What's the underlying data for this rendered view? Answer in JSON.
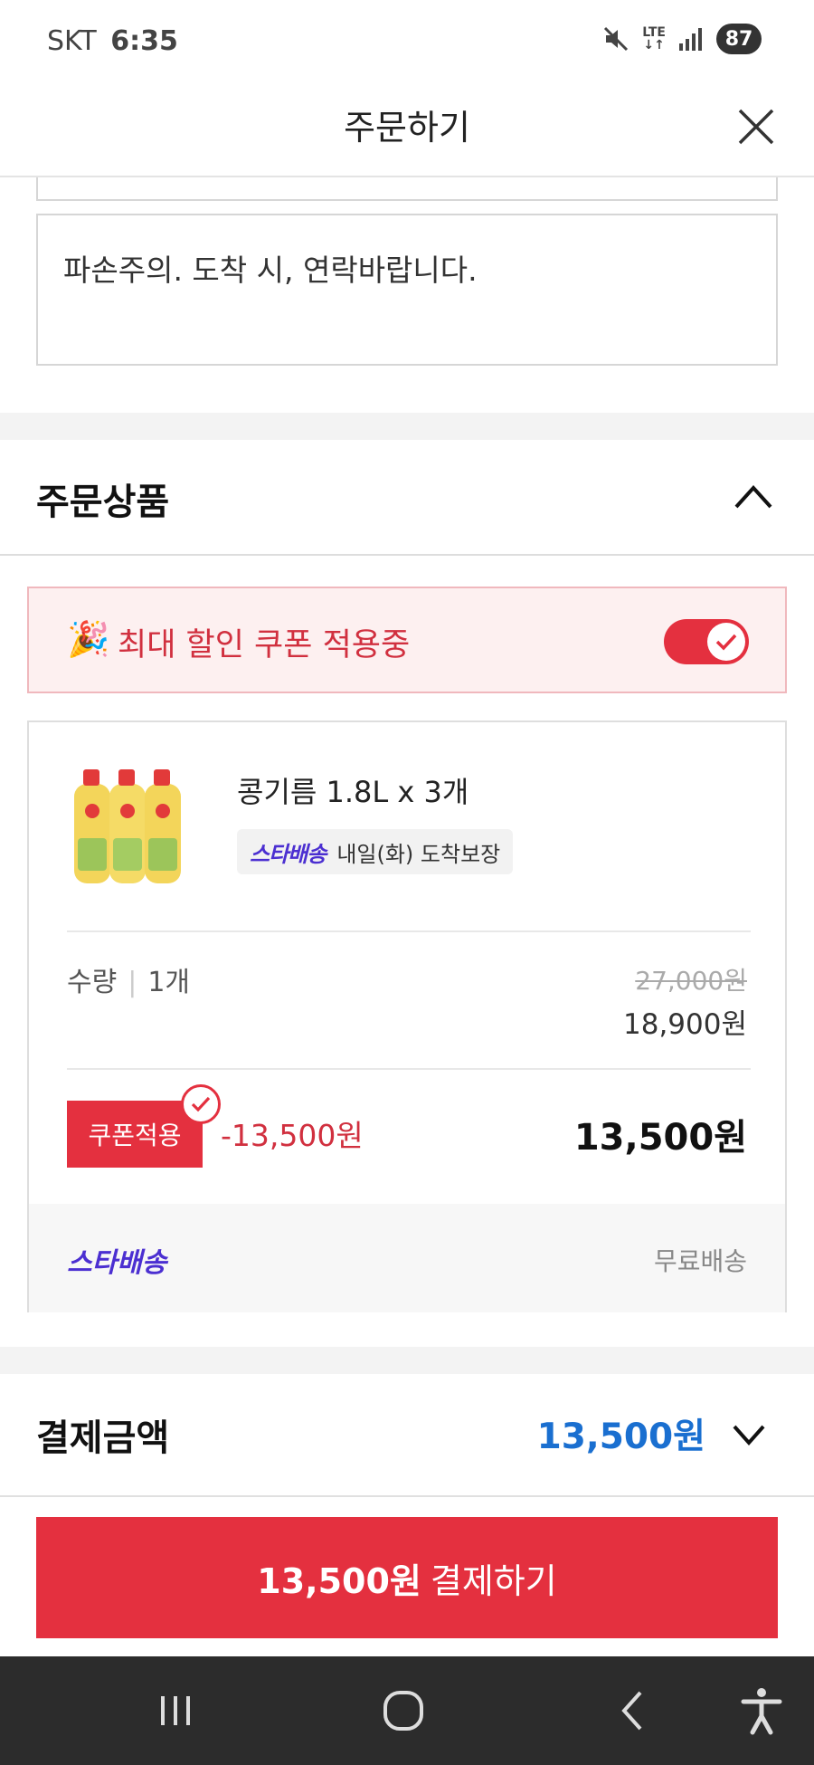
{
  "status_bar": {
    "carrier": "SKT",
    "time": "6:35",
    "lte": "LTE",
    "battery": "87"
  },
  "header": {
    "title": "주문하기"
  },
  "memo": {
    "text": "파손주의. 도착 시, 연락바랍니다."
  },
  "order_section": {
    "title": "주문상품"
  },
  "coupon_banner": {
    "text": "최대 할인 쿠폰 적용중",
    "toggle_on": true
  },
  "product": {
    "name": "콩기름 1.8L x 3개",
    "delivery_badge_logo": "스타배송",
    "delivery_badge_text": "내일(화) 도착보장",
    "qty_label": "수량",
    "qty_value": "1개",
    "original_price": "27,000원",
    "sale_price": "18,900원",
    "coupon_button": "쿠폰적용",
    "discount": "-13,500원",
    "final_price": "13,500원",
    "shipping_logo": "스타배송",
    "shipping_fee": "무료배송"
  },
  "payment": {
    "title": "결제금액",
    "amount": "13,500원"
  },
  "pay_button": {
    "amount": "13,500원",
    "label": "결제하기"
  },
  "colors": {
    "accent_red": "#e4303f",
    "amount_blue": "#1a6fd0",
    "star_purple": "#4b2fd1"
  }
}
